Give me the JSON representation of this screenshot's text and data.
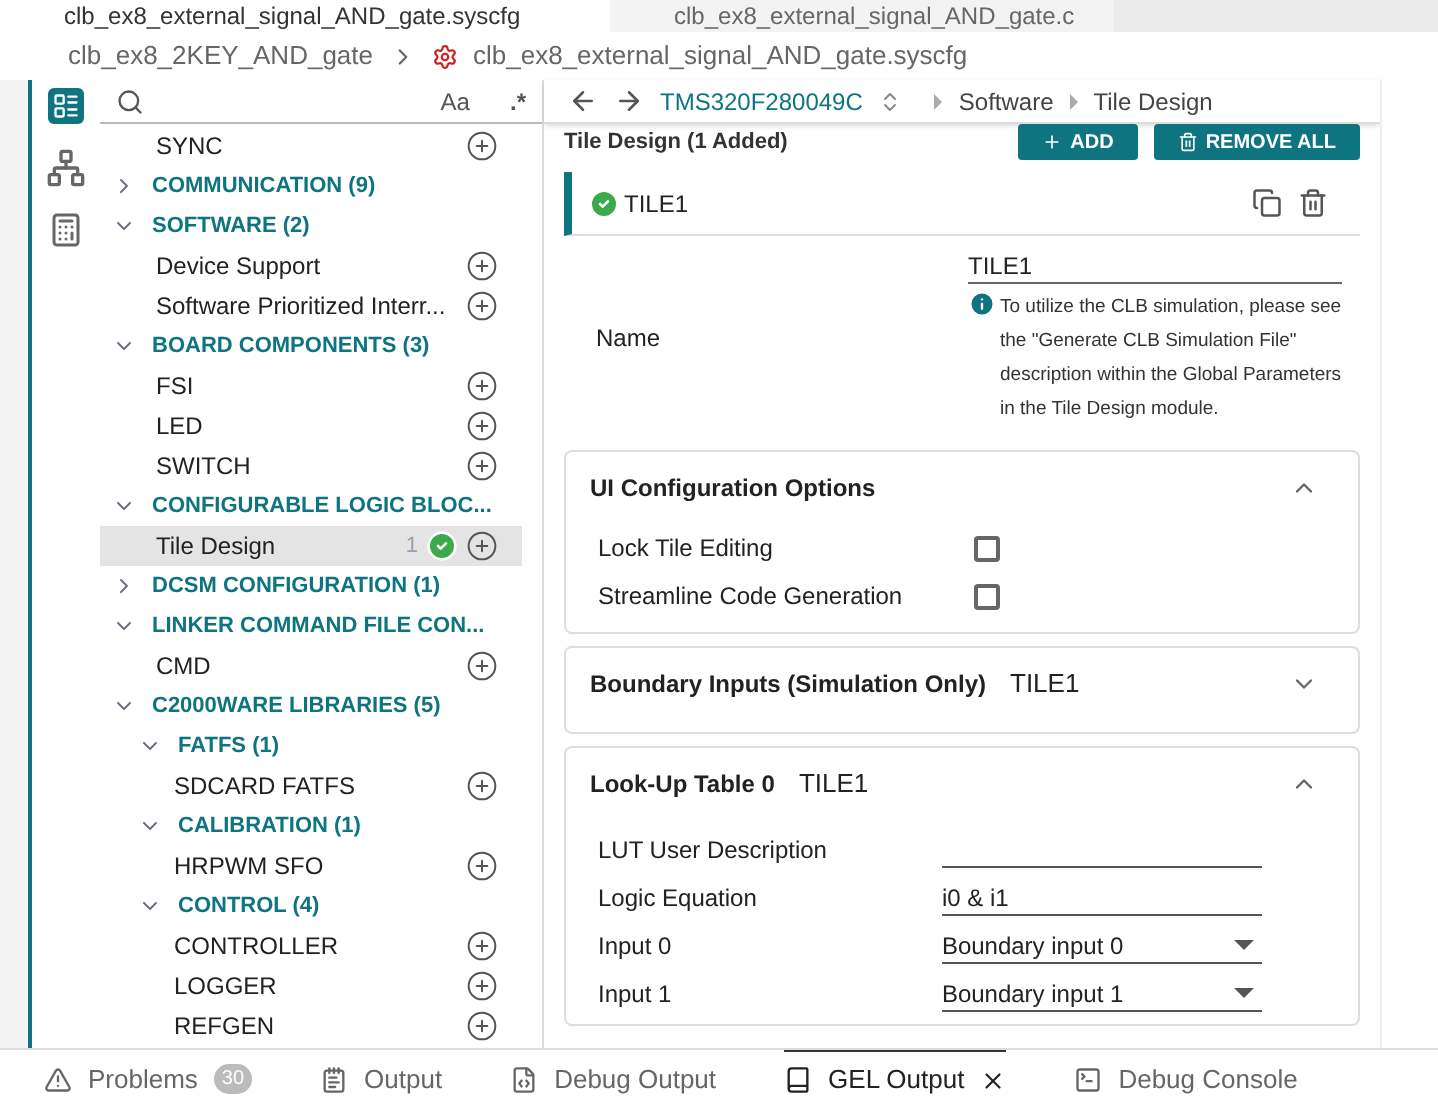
{
  "editor_tabs": [
    {
      "label": "clb_ex8_external_signal_AND_gate.syscfg",
      "selected": true
    },
    {
      "label": "clb_ex8_external_signal_AND_gate.c",
      "selected": false
    }
  ],
  "breadcrumb": [
    "clb_ex8_2KEY_AND_gate",
    "clb_ex8_external_signal_AND_gate.syscfg"
  ],
  "search": {
    "case_label": "Aa",
    "regex_label": ".*"
  },
  "tree": [
    {
      "kind": "item",
      "label": "SYNC",
      "selected": false
    },
    {
      "kind": "group",
      "label": "COMMUNICATION (9)",
      "expanded": false
    },
    {
      "kind": "group",
      "label": "SOFTWARE (2)",
      "expanded": true,
      "children": [
        {
          "kind": "item",
          "label": "Device Support",
          "selected": false
        },
        {
          "kind": "item",
          "label": "Software Prioritized Interr...",
          "selected": false
        }
      ]
    },
    {
      "kind": "group",
      "label": "BOARD COMPONENTS (3)",
      "expanded": true,
      "children": [
        {
          "kind": "item",
          "label": "FSI",
          "selected": false
        },
        {
          "kind": "item",
          "label": "LED",
          "selected": false
        },
        {
          "kind": "item",
          "label": "SWITCH",
          "selected": false
        }
      ]
    },
    {
      "kind": "group",
      "label": "CONFIGURABLE LOGIC BLOC...",
      "expanded": true,
      "children": [
        {
          "kind": "item",
          "label": "Tile Design",
          "selected": true,
          "count": "1"
        }
      ]
    },
    {
      "kind": "group",
      "label": "DCSM CONFIGURATION (1)",
      "expanded": false
    },
    {
      "kind": "group",
      "label": "LINKER COMMAND FILE CON...",
      "expanded": true,
      "children": [
        {
          "kind": "item",
          "label": "CMD",
          "selected": false
        }
      ]
    },
    {
      "kind": "group",
      "label": "C2000WARE LIBRARIES (5)",
      "expanded": true,
      "children": [
        {
          "kind": "group",
          "label": "FATFS (1)",
          "expanded": true,
          "children": [
            {
              "kind": "item",
              "label": "SDCARD FATFS",
              "selected": false
            }
          ]
        },
        {
          "kind": "group",
          "label": "CALIBRATION (1)",
          "expanded": true,
          "children": [
            {
              "kind": "item",
              "label": "HRPWM SFO",
              "selected": false
            }
          ]
        },
        {
          "kind": "group",
          "label": "CONTROL (4)",
          "expanded": true,
          "children": [
            {
              "kind": "item",
              "label": "CONTROLLER",
              "selected": false
            },
            {
              "kind": "item",
              "label": "LOGGER",
              "selected": false
            },
            {
              "kind": "item",
              "label": "REFGEN",
              "selected": false
            }
          ]
        }
      ]
    }
  ],
  "nav": {
    "device": "TMS320F280049C",
    "path": [
      "Software",
      "Tile Design"
    ]
  },
  "module": {
    "title": "Tile Design (1 Added)",
    "buttons": [
      "ADD",
      "REMOVE ALL"
    ]
  },
  "instance": {
    "name": "TILE1",
    "name_label": "Name",
    "name_value": "TILE1",
    "info": "To utilize the CLB simulation, please see the \"Generate CLB Simulation File\" description within the Global Parameters in the Tile Design module."
  },
  "sections": [
    {
      "title": "UI Configuration Options",
      "expanded": true,
      "rows": [
        {
          "kind": "checkbox",
          "label": "Lock Tile Editing",
          "checked": false
        },
        {
          "kind": "checkbox",
          "label": "Streamline Code Generation",
          "checked": false
        }
      ]
    },
    {
      "title": "Boundary Inputs (Simulation Only)",
      "tag": "TILE1",
      "expanded": false
    },
    {
      "title": "Look-Up Table 0",
      "tag": "TILE1",
      "expanded": true,
      "rows": [
        {
          "kind": "text",
          "label": "LUT User Description",
          "value": ""
        },
        {
          "kind": "text",
          "label": "Logic Equation",
          "value": "i0 & i1"
        },
        {
          "kind": "select",
          "label": "Input 0",
          "value": "Boundary input 0"
        },
        {
          "kind": "select",
          "label": "Input 1",
          "value": "Boundary input 1"
        }
      ]
    }
  ],
  "panel_tabs": [
    {
      "kind": "warning",
      "label": "Problems",
      "badge": "30",
      "selected": false
    },
    {
      "kind": "output",
      "label": "Output",
      "selected": false
    },
    {
      "kind": "debug",
      "label": "Debug Output",
      "selected": false
    },
    {
      "kind": "gel",
      "label": "GEL Output",
      "selected": true,
      "closable": true
    },
    {
      "kind": "console",
      "label": "Debug Console",
      "selected": false
    }
  ]
}
